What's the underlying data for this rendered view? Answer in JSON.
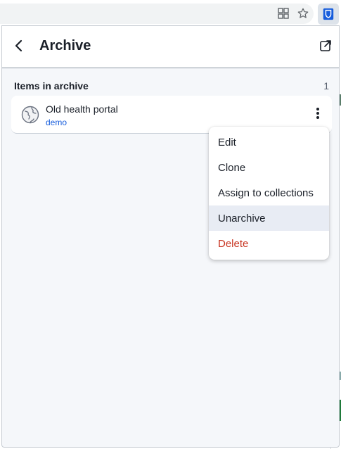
{
  "browser": {
    "icons": [
      "extensions-grid-icon",
      "star-icon",
      "bitwarden-extension-icon"
    ]
  },
  "header": {
    "title": "Archive"
  },
  "section": {
    "title": "Items in archive",
    "count": "1"
  },
  "item": {
    "name": "Old health portal",
    "subtitle": "demo",
    "icon": "globe-icon"
  },
  "menu": {
    "items": [
      {
        "label": "Edit"
      },
      {
        "label": "Clone"
      },
      {
        "label": "Assign to collections"
      },
      {
        "label": "Unarchive"
      },
      {
        "label": "Delete"
      }
    ]
  },
  "colors": {
    "accent": "#175ddc",
    "danger": "#c83522",
    "hover": "#e8ecf4"
  }
}
